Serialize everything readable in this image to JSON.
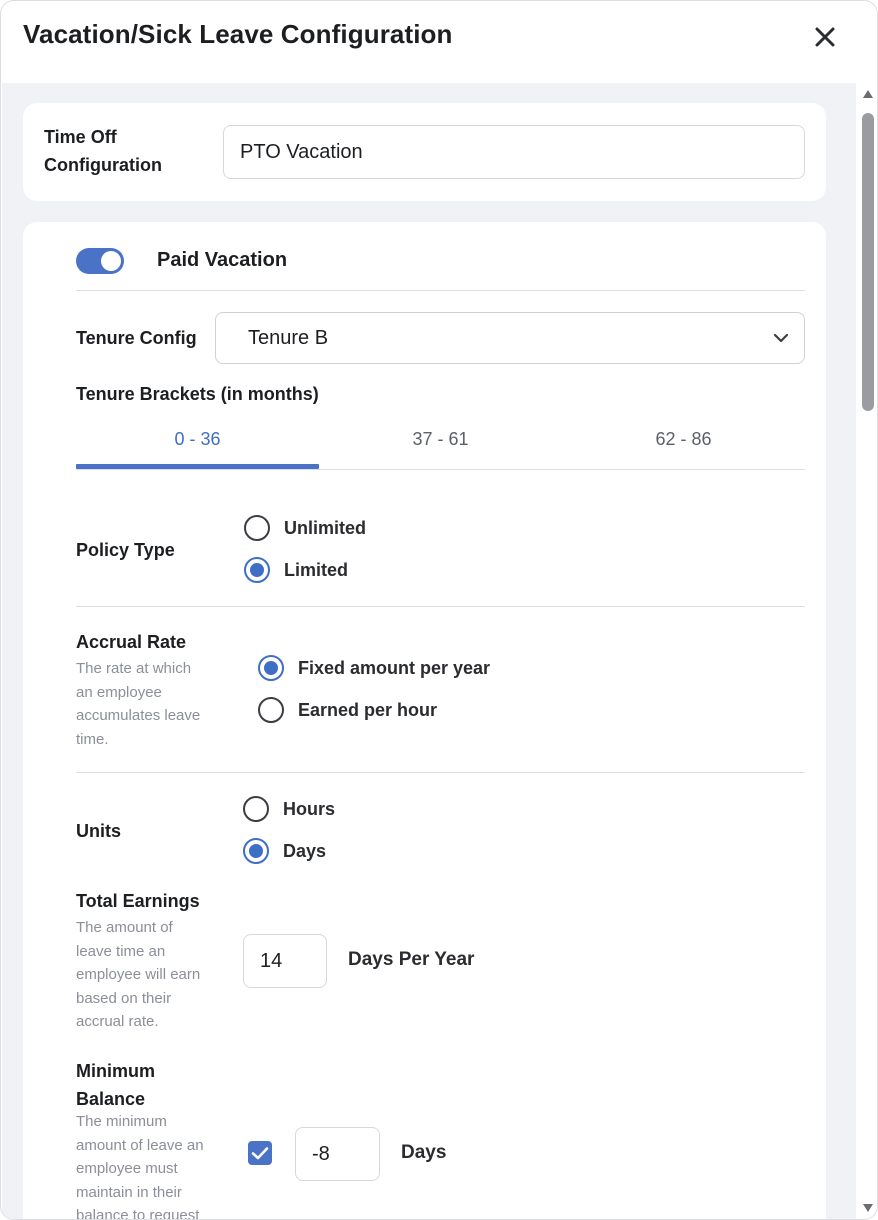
{
  "dialog": {
    "title": "Vacation/Sick Leave Configuration",
    "close_icon": "close-icon"
  },
  "time_off": {
    "label": "Time Off Configuration",
    "value": "PTO Vacation"
  },
  "paid_vacation": {
    "toggle_on": true,
    "label": "Paid Vacation"
  },
  "tenure_config": {
    "label": "Tenure Config",
    "selected": "Tenure B",
    "chevron_icon": "chevron-down-icon"
  },
  "tenure_brackets": {
    "label": "Tenure Brackets (in months)",
    "tabs": [
      "0 - 36",
      "37 - 61",
      "62 - 86"
    ],
    "active_index": 0
  },
  "policy_type": {
    "label": "Policy Type",
    "options": [
      "Unlimited",
      "Limited"
    ],
    "selected": "Limited"
  },
  "accrual_rate": {
    "label": "Accrual Rate",
    "description": [
      "The rate at which",
      "an employee",
      "accumulates leave",
      "time."
    ],
    "options": [
      "Fixed amount per year",
      "Earned per hour"
    ],
    "selected": "Fixed amount per year"
  },
  "units": {
    "label": "Units",
    "options": [
      "Hours",
      "Days"
    ],
    "selected": "Days"
  },
  "total_earnings": {
    "label": "Total Earnings",
    "description": [
      "The amount of",
      "leave time an",
      "employee will earn",
      "based on their",
      "accrual rate."
    ],
    "value": "14",
    "suffix": "Days Per Year"
  },
  "minimum_balance": {
    "label_lines": [
      "Minimum",
      "Balance"
    ],
    "description": [
      "The minimum",
      "amount of leave an",
      "employee must",
      "maintain in their",
      "balance to request"
    ],
    "checked": true,
    "value": "-8",
    "suffix": "Days"
  },
  "colors": {
    "accent": "#4a72c6",
    "background": "#f1f2f5"
  }
}
